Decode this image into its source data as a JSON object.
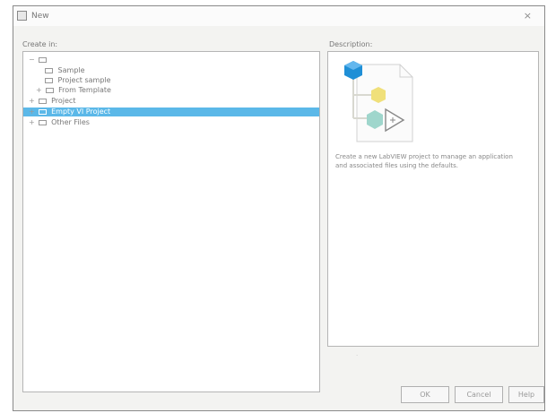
{
  "window": {
    "title": "New",
    "close_glyph": "×"
  },
  "left_label": "Create in:",
  "right_label": "Description:",
  "tree": [
    {
      "label": "",
      "level": 0
    },
    {
      "label": "Sample",
      "level": 2
    },
    {
      "label": "Project sample",
      "level": 2
    },
    {
      "label": "From Template",
      "level": 1
    },
    {
      "label": "Project",
      "level": 0
    },
    {
      "label": "Empty VI Project",
      "level": 0,
      "selected": true
    },
    {
      "label": "Other Files",
      "level": 0
    }
  ],
  "description": {
    "text": "Create a new LabVIEW project to manage an application and associated files using the defaults."
  },
  "buttons": {
    "ok": "OK",
    "cancel": "Cancel",
    "help": "Help"
  },
  "colors": {
    "selection": "#5bb8e8",
    "cube_blue": "#1f8fd6",
    "cube_yellow": "#f0e07a",
    "cube_teal": "#9fd6cc"
  }
}
